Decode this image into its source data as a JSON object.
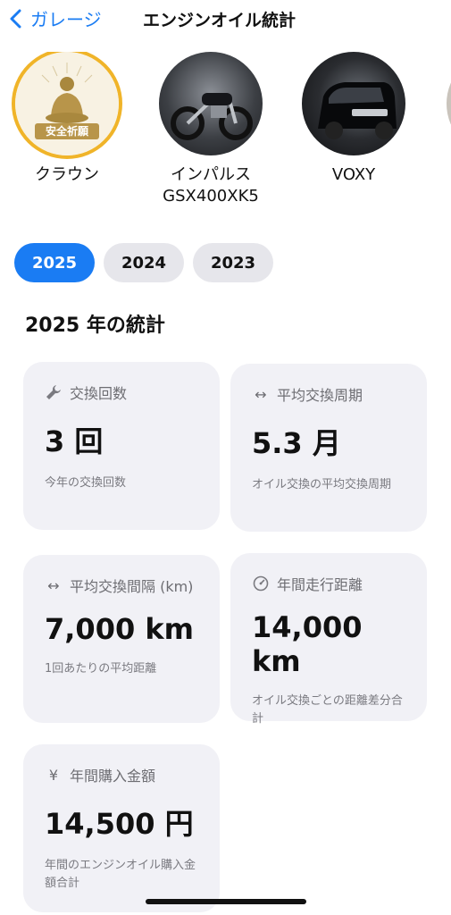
{
  "nav": {
    "back_label": "ガレージ",
    "title": "エンジンオイル統計"
  },
  "vehicles": [
    {
      "name": "クラウン",
      "badge_text": "安全祈願",
      "selected": true
    },
    {
      "name": "インパルス\nGSX400XK5",
      "selected": false
    },
    {
      "name": "VOXY",
      "selected": false
    }
  ],
  "years": [
    {
      "label": "2025",
      "active": true
    },
    {
      "label": "2024",
      "active": false
    },
    {
      "label": "2023",
      "active": false
    }
  ],
  "section_title": "2025 年の統計",
  "cards": [
    {
      "icon": "wrench-icon",
      "title": "交換回数",
      "value": "3 回",
      "desc": "今年の交換回数"
    },
    {
      "icon": "arrows-horizontal-icon",
      "title": "平均交換周期",
      "value": "5.3 月",
      "desc": "オイル交換の平均交換周期"
    },
    {
      "icon": "arrows-horizontal-icon",
      "title": "平均交換間隔 (km)",
      "value": "7,000 km",
      "desc": "1回あたりの平均距離"
    },
    {
      "icon": "speedometer-icon",
      "title": "年間走行距離",
      "value": "14,000 km",
      "desc": "オイル交換ごとの距離差分合計"
    },
    {
      "icon": "yen-icon",
      "title": "年間購入金額",
      "value": "14,500 円",
      "desc": "年間のエンジンオイル購入金額合計"
    }
  ],
  "colors": {
    "accent": "#1a7cf3",
    "card_bg": "#f1f1f6",
    "chip_bg": "#e6e6eb",
    "selected_ring": "#f0b429"
  }
}
